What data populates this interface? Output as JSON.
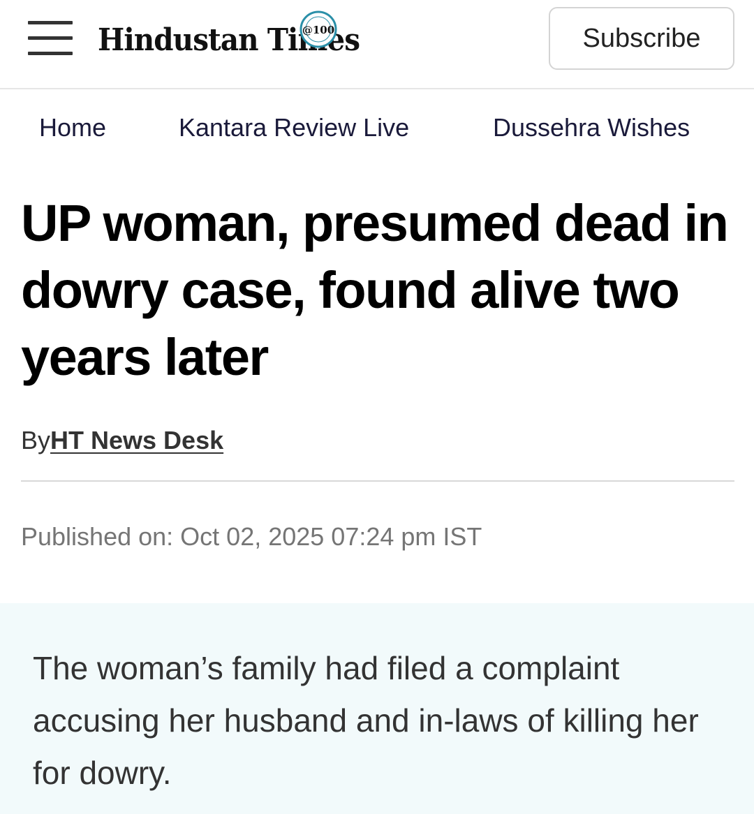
{
  "header": {
    "menu_icon": "hamburger-menu-icon",
    "logo_text": "Hindustan Times",
    "logo_badge": "@100",
    "subscribe_label": "Subscribe"
  },
  "nav": {
    "items": [
      {
        "label": "Home"
      },
      {
        "label": "Kantara Review Live"
      },
      {
        "label": "Dussehra Wishes"
      }
    ]
  },
  "article": {
    "headline": "UP woman, presumed dead in dowry case, found alive two years later",
    "byline_prefix": "By",
    "author": "HT News Desk",
    "published": "Published on: Oct 02, 2025 07:24 pm IST",
    "summary": "The woman’s family had filed a complaint accusing her husband and in-laws of killing her for dowry."
  },
  "colors": {
    "summary_background": "#f2fafb",
    "published_text": "#757575",
    "nav_text": "#1a1a3a"
  }
}
